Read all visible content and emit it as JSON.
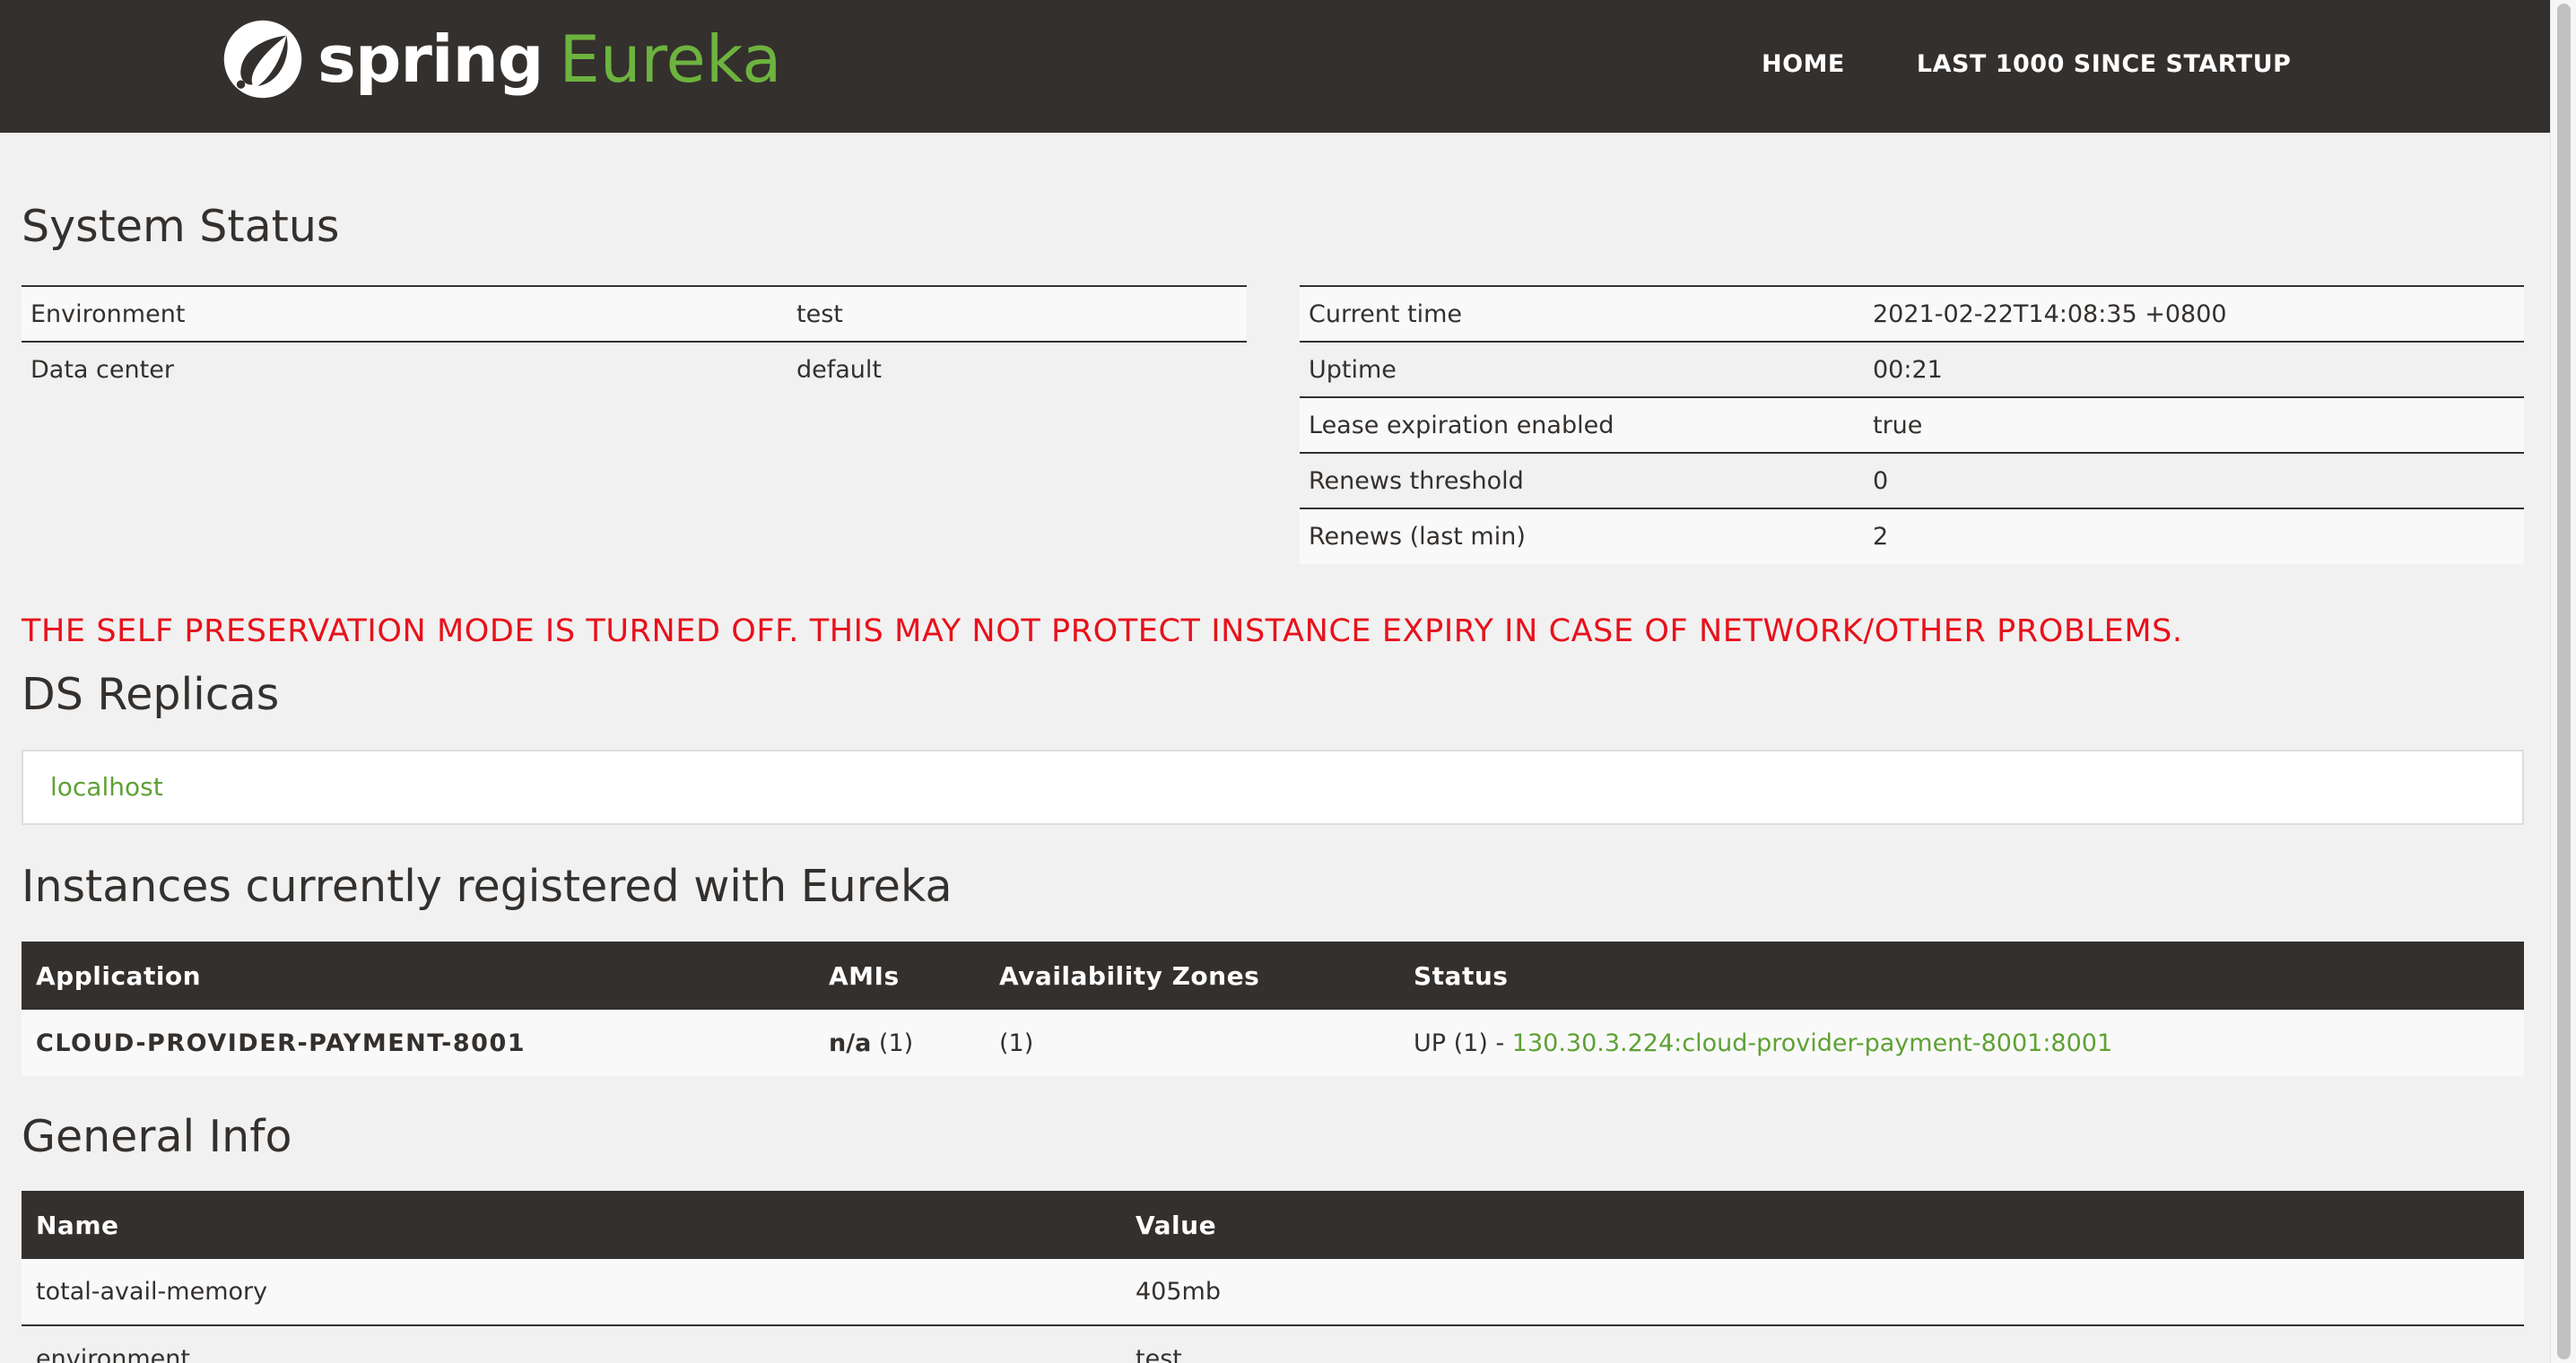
{
  "brand": {
    "spring": "spring",
    "eureka": "Eureka"
  },
  "nav": {
    "home": "HOME",
    "last1000": "LAST 1000 SINCE STARTUP"
  },
  "system_status": {
    "title": "System Status",
    "left": [
      {
        "label": "Environment",
        "value": "test"
      },
      {
        "label": "Data center",
        "value": "default"
      }
    ],
    "right": [
      {
        "label": "Current time",
        "value": "2021-02-22T14:08:35 +0800"
      },
      {
        "label": "Uptime",
        "value": "00:21"
      },
      {
        "label": "Lease expiration enabled",
        "value": "true"
      },
      {
        "label": "Renews threshold",
        "value": "0"
      },
      {
        "label": "Renews (last min)",
        "value": "2"
      }
    ]
  },
  "warning": "THE SELF PRESERVATION MODE IS TURNED OFF. THIS MAY NOT PROTECT INSTANCE EXPIRY IN CASE OF NETWORK/OTHER PROBLEMS.",
  "ds_replicas": {
    "title": "DS Replicas",
    "items": [
      "localhost"
    ]
  },
  "instances": {
    "title": "Instances currently registered with Eureka",
    "headers": [
      "Application",
      "AMIs",
      "Availability Zones",
      "Status"
    ],
    "rows": [
      {
        "application": "CLOUD-PROVIDER-PAYMENT-8001",
        "ami_bold": "n/a",
        "ami_count": "(1)",
        "zones": "(1)",
        "status_prefix": "UP (1) - ",
        "status_link": "130.30.3.224:cloud-provider-payment-8001:8001"
      }
    ]
  },
  "general_info": {
    "title": "General Info",
    "headers": [
      "Name",
      "Value"
    ],
    "rows": [
      {
        "name": "total-avail-memory",
        "value": "405mb"
      },
      {
        "name": "environment",
        "value": "test"
      }
    ]
  },
  "colors": {
    "navbar": "#34302d",
    "spring_green": "#6db33f",
    "link_green": "#5fa134",
    "warning_red": "#e8111b",
    "background": "#f1f1f1"
  }
}
